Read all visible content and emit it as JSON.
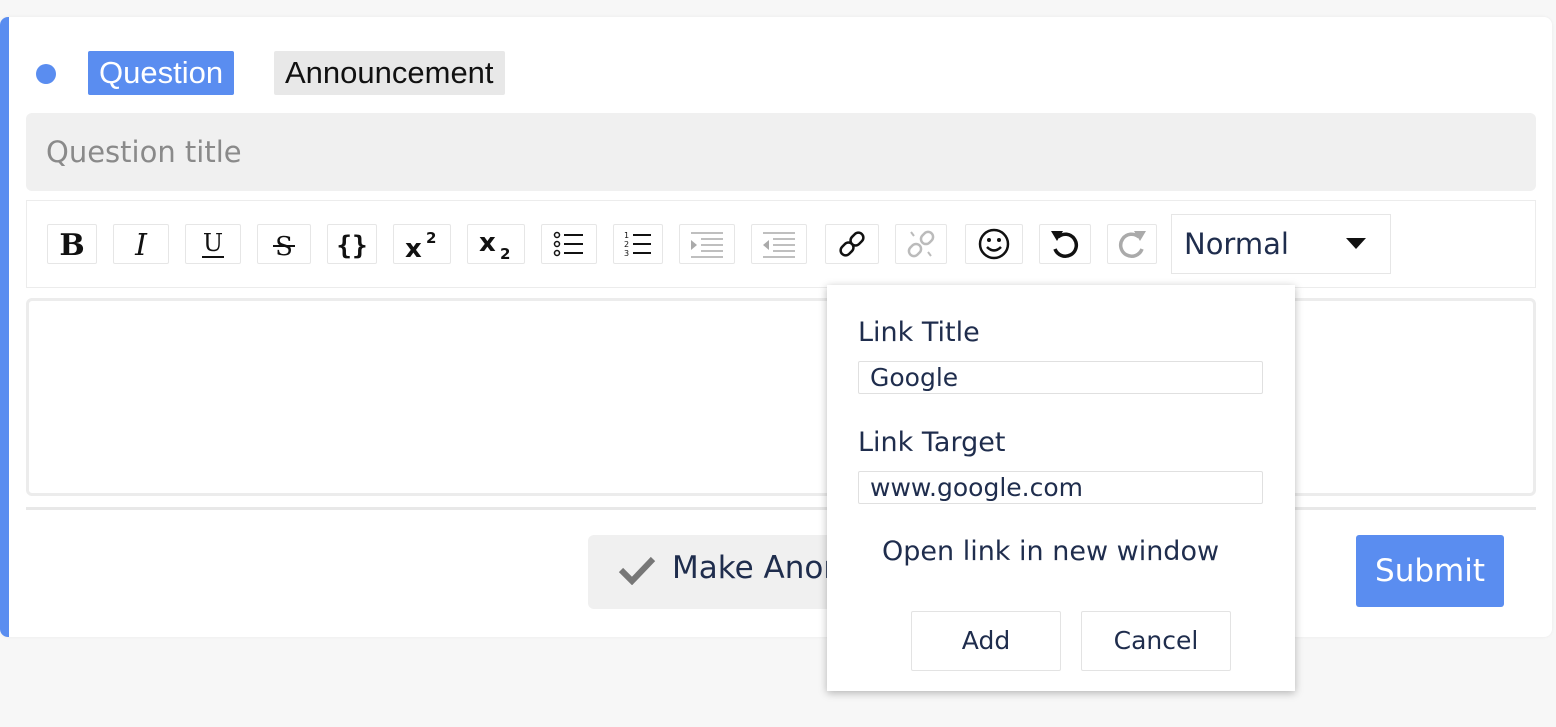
{
  "post_type": {
    "tabs": [
      {
        "label": "Question",
        "selected": true
      },
      {
        "label": "Announcement",
        "selected": false
      }
    ]
  },
  "title_field": {
    "placeholder": "Question title",
    "value": ""
  },
  "toolbar": {
    "buttons": [
      {
        "icon": "bold-icon",
        "state": "enabled"
      },
      {
        "icon": "italic-icon",
        "state": "enabled"
      },
      {
        "icon": "underline-icon",
        "state": "enabled"
      },
      {
        "icon": "strikethrough-icon",
        "state": "enabled"
      },
      {
        "icon": "code-icon",
        "state": "enabled"
      },
      {
        "icon": "superscript-icon",
        "state": "enabled"
      },
      {
        "icon": "subscript-icon",
        "state": "enabled"
      },
      {
        "icon": "unordered-list-icon",
        "state": "enabled"
      },
      {
        "icon": "ordered-list-icon",
        "state": "enabled"
      },
      {
        "icon": "indent-icon",
        "state": "disabled"
      },
      {
        "icon": "outdent-icon",
        "state": "disabled"
      },
      {
        "icon": "link-icon",
        "state": "active"
      },
      {
        "icon": "unlink-icon",
        "state": "disabled"
      },
      {
        "icon": "emoji-icon",
        "state": "enabled"
      },
      {
        "icon": "undo-icon",
        "state": "enabled"
      },
      {
        "icon": "redo-icon",
        "state": "disabled"
      }
    ],
    "block_type": "Normal"
  },
  "actions": {
    "anonymous_label": "Make Anonymous",
    "submit_label": "Submit"
  },
  "link_popup": {
    "title_label": "Link Title",
    "title_value": "Google",
    "target_label": "Link Target",
    "target_value": "www.google.com",
    "new_window_label": "Open link in new window",
    "add_label": "Add",
    "cancel_label": "Cancel"
  },
  "colors": {
    "accent": "#5a8df0",
    "text_dark": "#1f2d4d",
    "field_background": "#f0f0f0"
  }
}
